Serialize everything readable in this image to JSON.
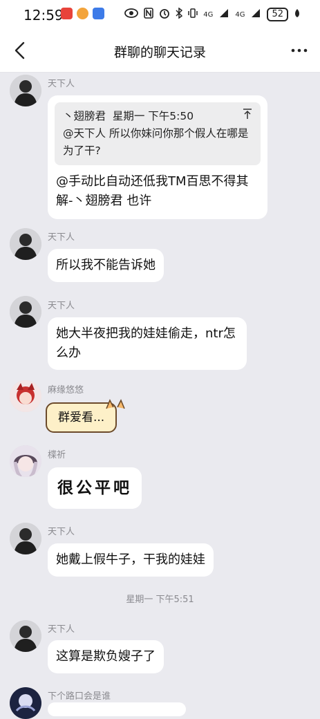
{
  "status": {
    "time": "12:59",
    "signal1": "4G",
    "signal2": "4G",
    "battery": "52"
  },
  "header": {
    "title": "群聊的聊天记录"
  },
  "messages": [
    {
      "sender": "天下人",
      "quote": {
        "author": "丶翅膀君",
        "time": "星期一 下午5:50",
        "text": "@天下人 所以你妹问你那个假人在哪是为了干?"
      },
      "text": "@手动比自动还低我TM百思不得其解-丶翅膀君 也许"
    },
    {
      "sender": "天下人",
      "text": "所以我不能告诉她"
    },
    {
      "sender": "天下人",
      "text": "她大半夜把我的娃娃偷走，ntr怎么办"
    },
    {
      "sender": "麻缘悠悠",
      "text": "群爱看..."
    },
    {
      "sender": "楪祈",
      "text": "很公平吧"
    },
    {
      "sender": "天下人",
      "text": "她戴上假牛子，干我的娃娃"
    },
    {
      "sender": "天下人",
      "text": "这算是欺负嫂子了"
    },
    {
      "sender": "下个路口会是谁",
      "text": ""
    }
  ],
  "timestamp": "星期一 下午5:51",
  "colors": {
    "background": "#eaeaef",
    "bubble": "#ffffff",
    "quote_bg": "#ededee",
    "sender_text": "#8a8a8f",
    "cartoon_bubble": "#fdf0c8"
  }
}
